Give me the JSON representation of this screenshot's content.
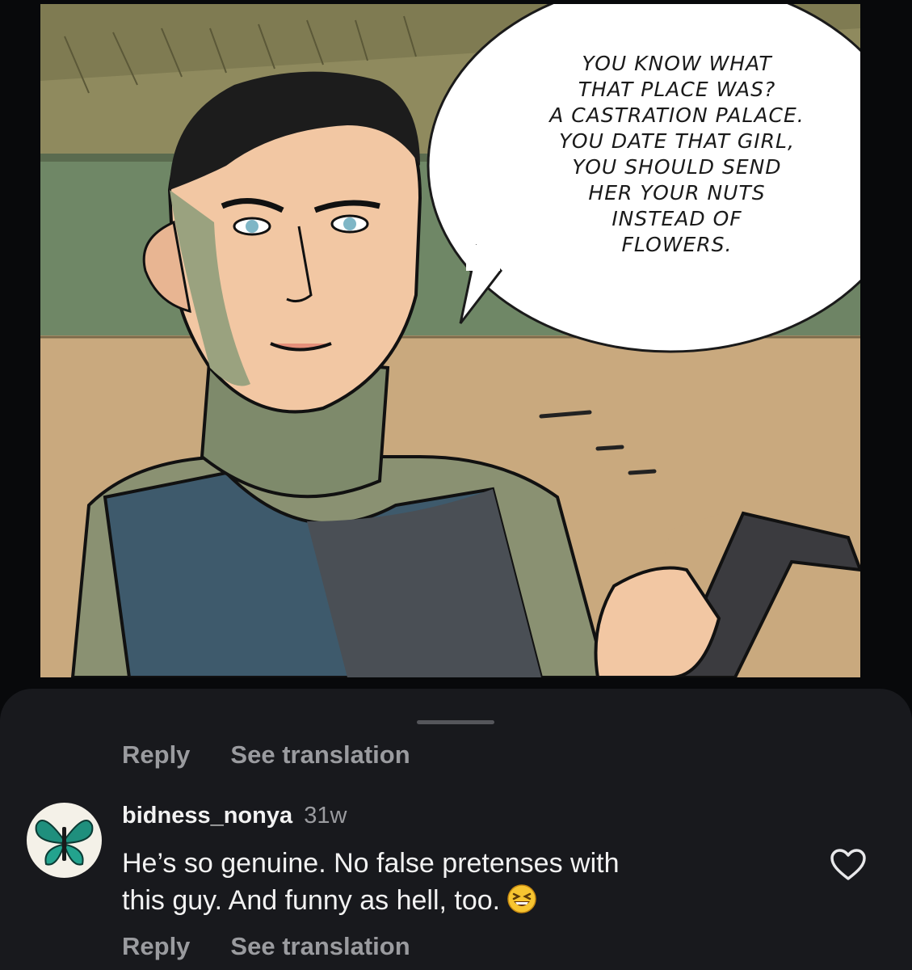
{
  "comic_panel": {
    "speech_lines": [
      "YOU KNOW WHAT",
      "THAT PLACE WAS?",
      "A CASTRATION PALACE.",
      "YOU DATE THAT GIRL,",
      "YOU SHOULD SEND",
      "HER YOUR NUTS",
      "INSTEAD OF",
      "FLOWERS."
    ]
  },
  "previous_comment": {
    "reply_label": "Reply",
    "translate_label": "See translation"
  },
  "comment": {
    "username": "bidness_nonya",
    "time": "31w",
    "text_line1": "He’s so genuine. No false pretenses with",
    "text_line2": "this guy. And funny as hell, too.",
    "emoji": "grinning-squinting-face",
    "reply_label": "Reply",
    "translate_label": "See translation",
    "like_icon": "heart-outline-icon",
    "avatar": "butterfly-avatar"
  },
  "colors": {
    "sheet_background": "#18191d",
    "muted_text": "#9a9b9f",
    "primary_text": "#f2f2f2"
  }
}
